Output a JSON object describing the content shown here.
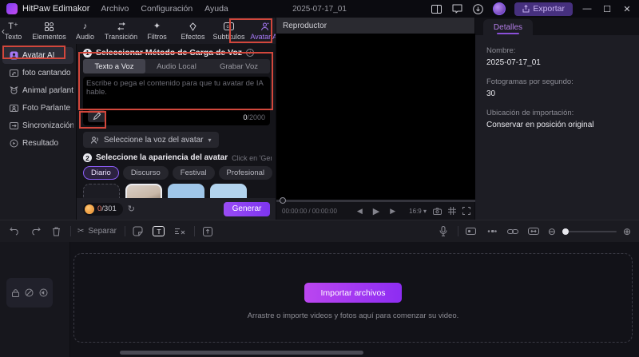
{
  "titlebar": {
    "app_name": "HitPaw Edimakor",
    "menus": [
      {
        "label": "Archivo"
      },
      {
        "label": "Configuración"
      },
      {
        "label": "Ayuda"
      }
    ],
    "project_title": "2025-07-17_01",
    "export_label": "Exportar",
    "minimize": "—",
    "maximize": "☐",
    "close": "✕"
  },
  "ribbon": {
    "back_chevron": "‹",
    "items": [
      {
        "label": "Texto"
      },
      {
        "label": "Elementos"
      },
      {
        "label": "Audio"
      },
      {
        "label": "Transición"
      },
      {
        "label": "Filtros"
      },
      {
        "label": "Efectos"
      },
      {
        "label": "Subtítulos"
      },
      {
        "label": "Avatar AI"
      }
    ]
  },
  "sidebar": {
    "items": [
      {
        "label": "Avatar AI"
      },
      {
        "label": "foto cantando"
      },
      {
        "label": "Animal parlante"
      },
      {
        "label": "Foto Parlante"
      },
      {
        "label": "Sincronización..."
      },
      {
        "label": "Resultado"
      }
    ]
  },
  "panel": {
    "step1": {
      "number": "1",
      "title": "Seleccionar Método de Carga de Voz",
      "info": "i"
    },
    "voice_tabs": [
      {
        "label": "Texto a Voz"
      },
      {
        "label": "Audio Local"
      },
      {
        "label": "Grabar Voz"
      }
    ],
    "textarea_placeholder": "Escribe o pega el contenido para que tu avatar de IA hable.",
    "char_counter": {
      "current": "0",
      "max": "/2000"
    },
    "voice_select_label": "Seleccione la voz del avatar",
    "step2": {
      "number": "2",
      "title": "Seleccione la apariencia del avatar",
      "hint": "Click en 'Generar' para vi"
    },
    "categories": [
      {
        "label": "Diario"
      },
      {
        "label": "Discurso"
      },
      {
        "label": "Festival"
      },
      {
        "label": "Profesional"
      }
    ],
    "credits": {
      "current": "0",
      "max": "/301"
    },
    "generate_label": "Generar"
  },
  "player": {
    "header": "Reproductor",
    "timecode": "00:00:00 / 00:00:00",
    "aspect_ratio": "16:9"
  },
  "details": {
    "tab_label": "Detalles",
    "fields": [
      {
        "label": "Nombre:",
        "value": "2025-07-17_01"
      },
      {
        "label": "Fotogramas por segundo:",
        "value": "30"
      },
      {
        "label": "Ubicación de importación:",
        "value": "Conservar en posición original"
      }
    ]
  },
  "timeline": {
    "separate_label": "Separar",
    "import_button_label": "Importar archivos",
    "drop_hint": "Arrastre o importe videos y fotos aquí para comenzar su video."
  },
  "colors": {
    "accent_purple": "#8a5cf5",
    "annotation_red": "#d2473c",
    "generate_gradient_start": "#9a4cf5",
    "import_gradient_start": "#bb46f0",
    "coin_orange": "#e88a2a"
  }
}
